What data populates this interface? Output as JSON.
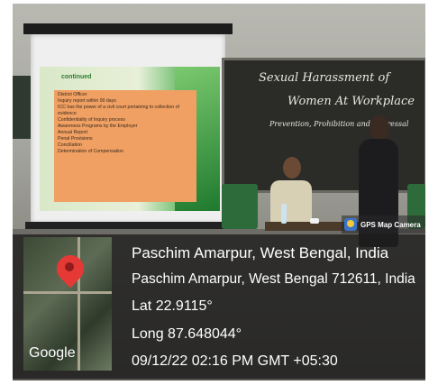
{
  "slide": {
    "heading": "continued",
    "items": [
      "District Officer",
      "Inquiry report within 90 days",
      "ICC has the power of a civil court pertaining to collection of evidence",
      "Confidentiality of Inquiry process",
      "Awareness Programs by the Employer",
      "Annual Report",
      "Penal Provisions",
      "Conciliation",
      "Determination of Compensation"
    ]
  },
  "blackboard": {
    "line1": "Sexual Harassment of",
    "line2": "Women At Workplace",
    "line3": "Prevention, Prohibition and Redressal"
  },
  "camera_badge": {
    "label": "GPS Map Camera",
    "icon": "gps-map-camera-icon"
  },
  "location": {
    "place": "Paschim Amarpur, West Bengal, India",
    "address": "Paschim Amarpur, West Bengal 712611, India",
    "lat": "Lat 22.9115°",
    "long": "Long 87.648044°",
    "datetime": "09/12/22 02:16 PM GMT +05:30"
  },
  "map": {
    "brand": "Google",
    "pin_icon": "map-pin-icon",
    "pin_color": "#e53935"
  }
}
